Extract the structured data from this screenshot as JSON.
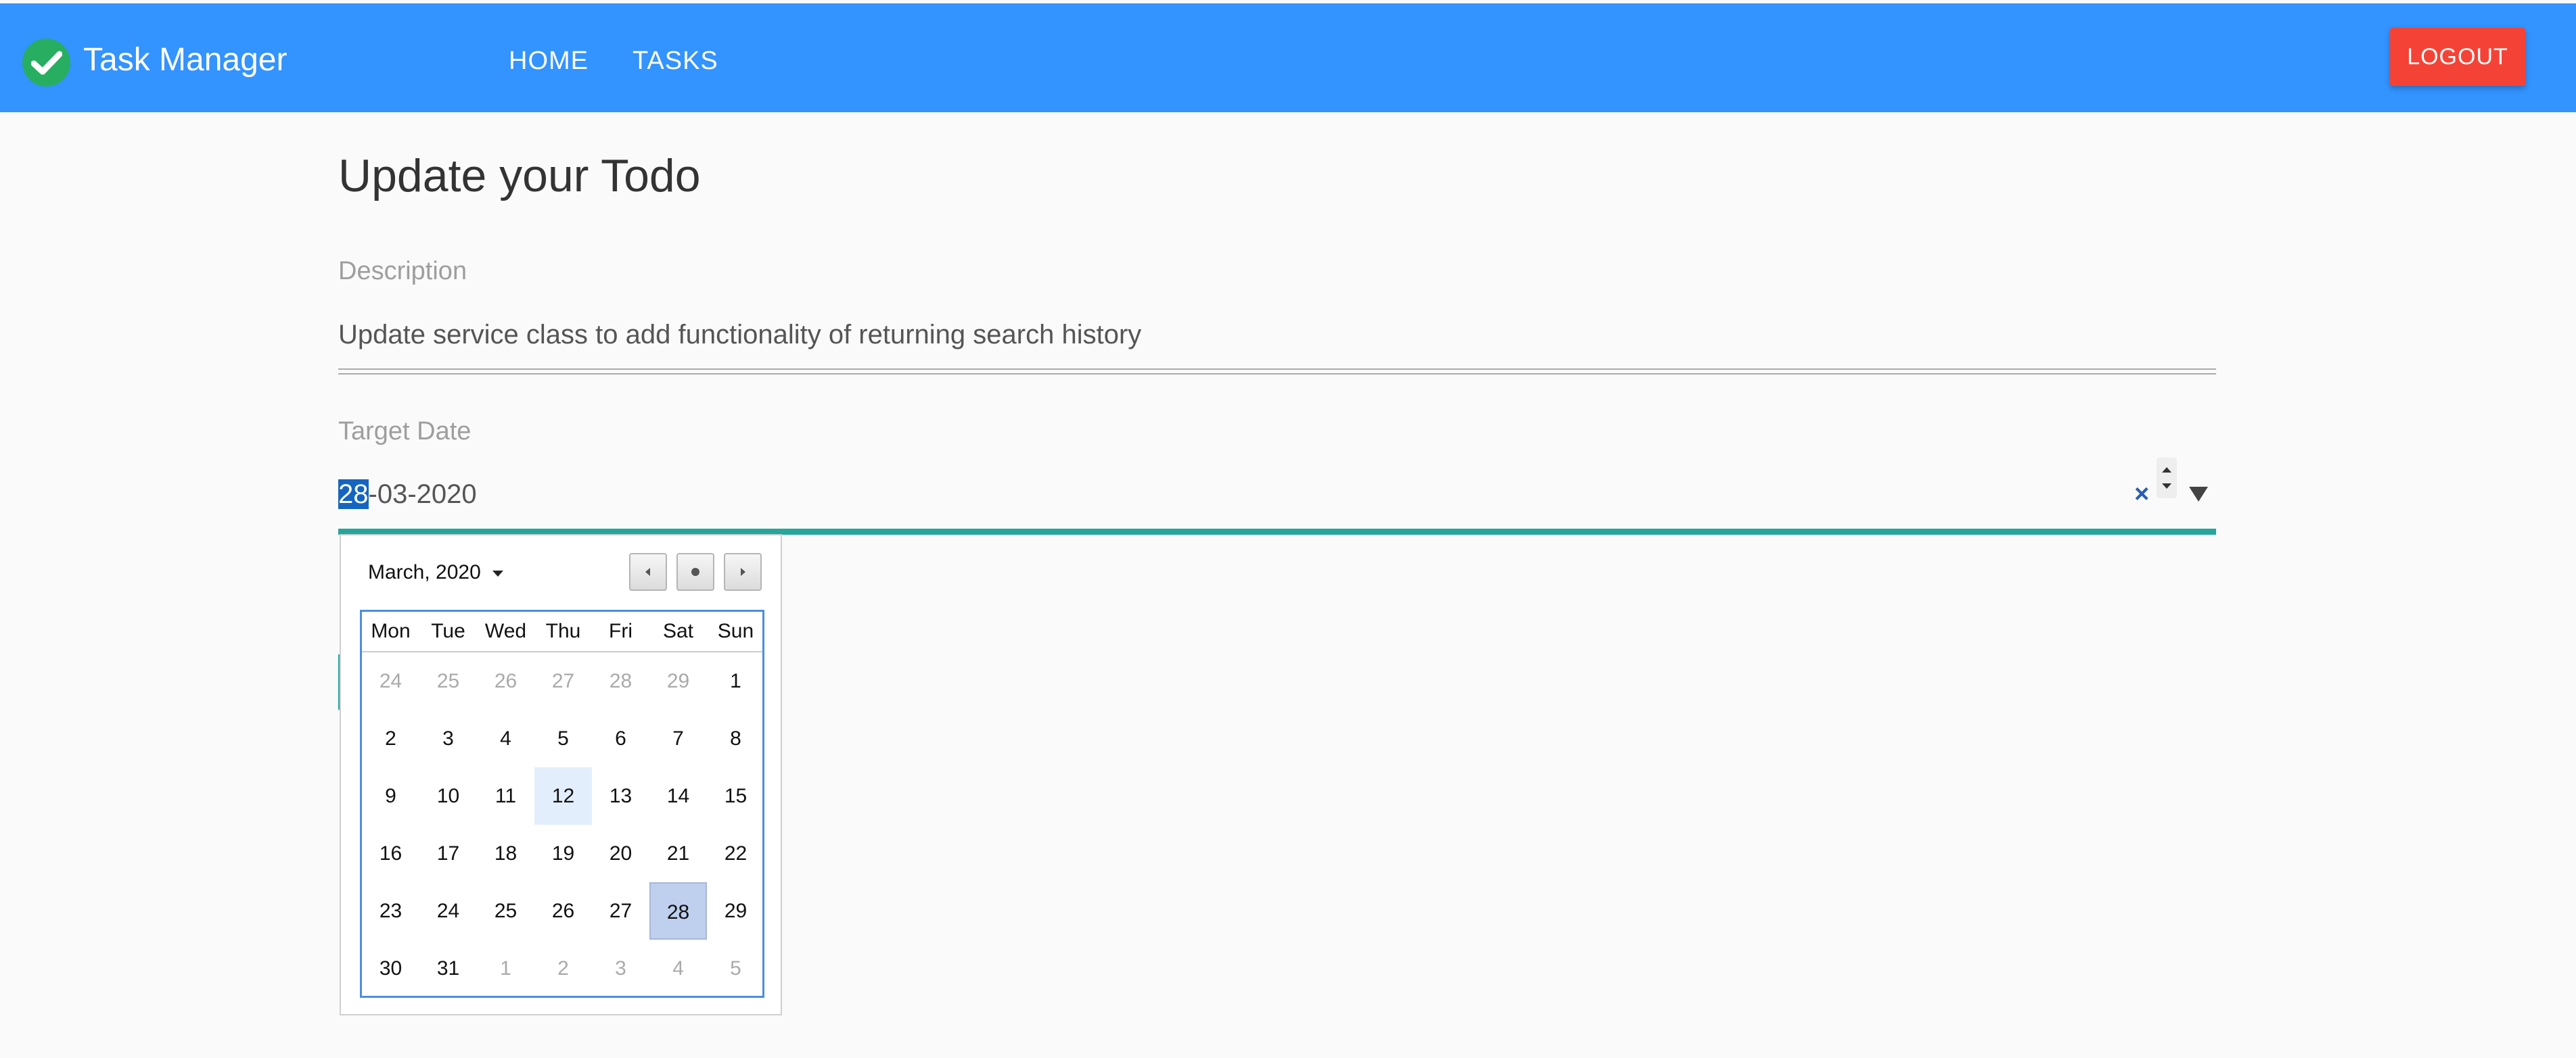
{
  "app": {
    "brand": "Task Manager"
  },
  "nav": {
    "home": "HOME",
    "tasks": "TASKS",
    "logout": "LOGOUT"
  },
  "form": {
    "title": "Update your Todo",
    "description_label": "Description",
    "description_value": "Update service class to add functionality of returning search history",
    "target_date_label": "Target Date",
    "target_date_day": "28",
    "target_date_rest": "-03-2020",
    "clear_icon": "×"
  },
  "calendar": {
    "month_label": "March, 2020",
    "weekdays": [
      "Mon",
      "Tue",
      "Wed",
      "Thu",
      "Fri",
      "Sat",
      "Sun"
    ],
    "weeks": [
      [
        "24",
        "25",
        "26",
        "27",
        "28",
        "29",
        "1"
      ],
      [
        "2",
        "3",
        "4",
        "5",
        "6",
        "7",
        "8"
      ],
      [
        "9",
        "10",
        "11",
        "12",
        "13",
        "14",
        "15"
      ],
      [
        "16",
        "17",
        "18",
        "19",
        "20",
        "21",
        "22"
      ],
      [
        "23",
        "24",
        "25",
        "26",
        "27",
        "28",
        "29"
      ],
      [
        "30",
        "31",
        "1",
        "2",
        "3",
        "4",
        "5"
      ]
    ],
    "other_month": [
      [
        true,
        true,
        true,
        true,
        true,
        true,
        false
      ],
      [
        false,
        false,
        false,
        false,
        false,
        false,
        false
      ],
      [
        false,
        false,
        false,
        false,
        false,
        false,
        false
      ],
      [
        false,
        false,
        false,
        false,
        false,
        false,
        false
      ],
      [
        false,
        false,
        false,
        false,
        false,
        false,
        false
      ],
      [
        false,
        false,
        true,
        true,
        true,
        true,
        true
      ]
    ],
    "today": "12",
    "selected": "28"
  },
  "colors": {
    "header": "#3393ff",
    "logout": "#f44336",
    "accent_underline": "#26a69a",
    "logo": "#27ae60"
  }
}
